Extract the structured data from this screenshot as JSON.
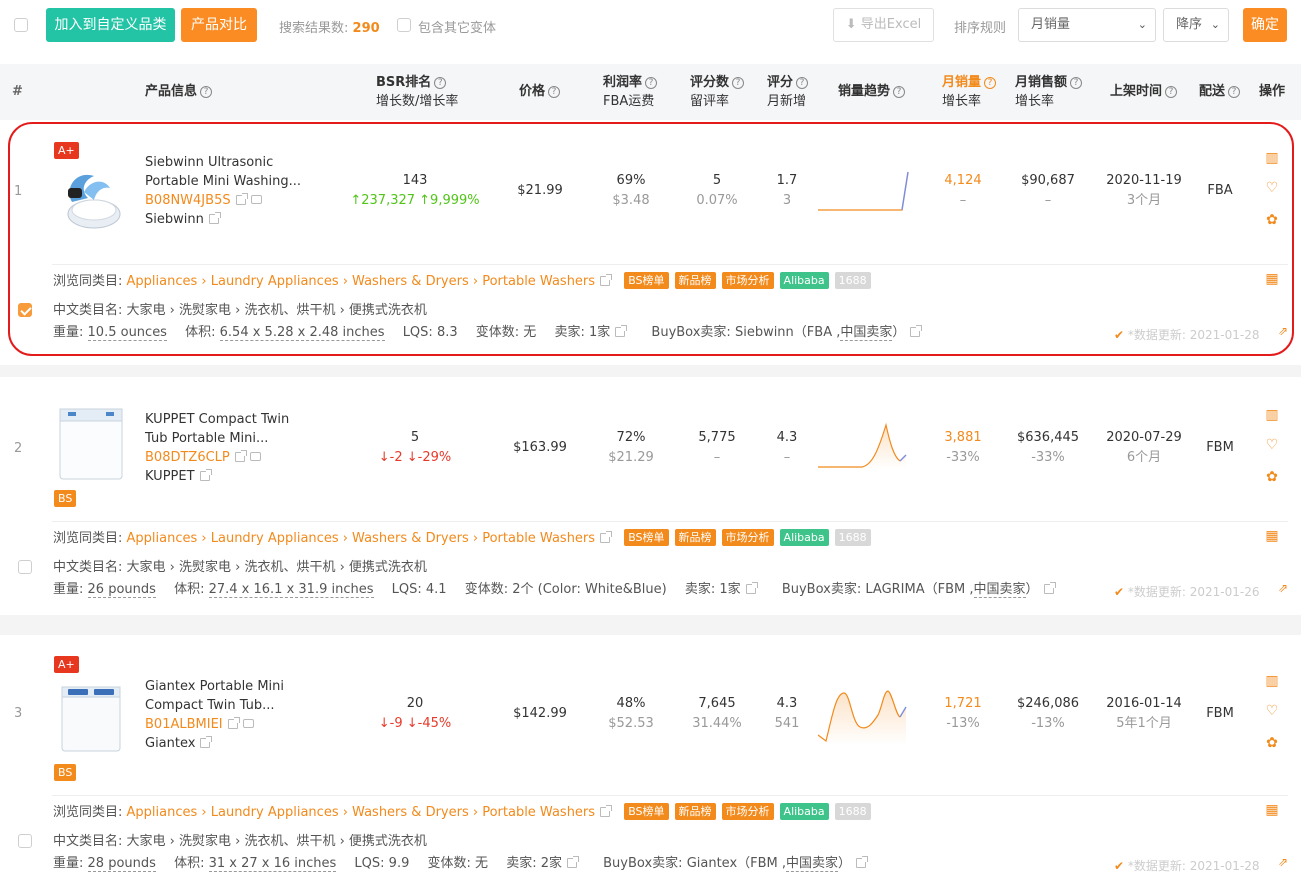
{
  "toolbar": {
    "add_custom": "加入到自定义品类",
    "compare": "产品对比",
    "result_label": "搜索结果数:",
    "result_count": "290",
    "include_variants": "包含其它变体",
    "export": "导出Excel",
    "sort_label": "排序规则",
    "sort_value": "月销量",
    "order_value": "降序",
    "confirm": "确定"
  },
  "header": {
    "index": "#",
    "product": "产品信息",
    "bsr": "BSR排名",
    "bsr_sub": "增长数/增长率",
    "price": "价格",
    "margin": "利润率",
    "margin_sub": "FBA运费",
    "reviews": "评分数",
    "reviews_sub": "留评率",
    "rating": "评分",
    "rating_sub": "月新增",
    "trend": "销量趋势",
    "monthly_sales": "月销量",
    "monthly_sales_sub": "增长率",
    "monthly_revenue": "月销售额",
    "monthly_revenue_sub": "增长率",
    "listed": "上架时间",
    "fulfill": "配送",
    "ops": "操作"
  },
  "labels": {
    "browse": "浏览同类目:",
    "cn_cat": "中文类目名:",
    "weight": "重量:",
    "volume": "体积:",
    "lqs": "LQS:",
    "variants": "变体数:",
    "sellers": "卖家:",
    "buybox": "BuyBox卖家:",
    "bs_list": "BS榜单",
    "new_list": "新品榜",
    "market": "市场分析",
    "alibaba": "Alibaba",
    "t1688": "1688",
    "updated": "*数据更新:"
  },
  "products": [
    {
      "index": "1",
      "badge_top": "A+",
      "badge_bottom": "",
      "name1": "Siebwinn Ultrasonic",
      "name2": "Portable Mini Washing...",
      "asin": "B08NW4JB5S",
      "brand": "Siebwinn",
      "bsr": "143",
      "bsr_change": "↑237,327 ↑9,999%",
      "bsr_dir": "up",
      "price": "$21.99",
      "margin": "69%",
      "fba_fee": "$3.48",
      "reviews": "5",
      "review_rate": "0.07%",
      "rating": "1.7",
      "rating_new": "3",
      "sales": "4,124",
      "sales_growth": "–",
      "revenue": "$90,687",
      "revenue_growth": "–",
      "listed": "2020-11-19",
      "listed_age": "3个月",
      "fulfill": "FBA",
      "category": "Appliances › Laundry Appliances › Washers & Dryers › Portable Washers",
      "cn_category": "大家电 › 洗熨家电 › 洗衣机、烘干机 › 便携式洗衣机",
      "weight": "10.5 ounces",
      "volume": "6.54 x 5.28 x 2.48 inches",
      "lqs": "8.3",
      "variants": "无",
      "sellers": "1家",
      "buybox_seller": "Siebwinn",
      "buybox_type": "（FBA ,",
      "buybox_region": "中国卖家",
      "buybox_close": "）",
      "update_date": "2021-01-28",
      "checked": true
    },
    {
      "index": "2",
      "badge_top": "",
      "badge_bottom": "BS",
      "name1": "KUPPET Compact Twin",
      "name2": "Tub Portable Mini...",
      "asin": "B08DTZ6CLP",
      "brand": "KUPPET",
      "bsr": "5",
      "bsr_change": "↓-2 ↓-29%",
      "bsr_dir": "down",
      "price": "$163.99",
      "margin": "72%",
      "fba_fee": "$21.29",
      "reviews": "5,775",
      "review_rate": "–",
      "rating": "4.3",
      "rating_new": "–",
      "sales": "3,881",
      "sales_growth": "-33%",
      "revenue": "$636,445",
      "revenue_growth": "-33%",
      "listed": "2020-07-29",
      "listed_age": "6个月",
      "fulfill": "FBM",
      "category": "Appliances › Laundry Appliances › Washers & Dryers › Portable Washers",
      "cn_category": "大家电 › 洗熨家电 › 洗衣机、烘干机 › 便携式洗衣机",
      "weight": "26 pounds",
      "volume": "27.4 x 16.1 x 31.9 inches",
      "lqs": "4.1",
      "variants": "2个 (Color: White&Blue)",
      "sellers": "1家",
      "buybox_seller": "LAGRIMA",
      "buybox_type": "（FBM ,",
      "buybox_region": "中国卖家",
      "buybox_close": "）",
      "update_date": "2021-01-26",
      "checked": false
    },
    {
      "index": "3",
      "badge_top": "A+",
      "badge_bottom": "BS",
      "name1": "Giantex Portable Mini",
      "name2": "Compact Twin Tub...",
      "asin": "B01ALBMIEI",
      "brand": "Giantex",
      "bsr": "20",
      "bsr_change": "↓-9 ↓-45%",
      "bsr_dir": "down",
      "price": "$142.99",
      "margin": "48%",
      "fba_fee": "$52.53",
      "reviews": "7,645",
      "review_rate": "31.44%",
      "rating": "4.3",
      "rating_new": "541",
      "sales": "1,721",
      "sales_growth": "-13%",
      "revenue": "$246,086",
      "revenue_growth": "-13%",
      "listed": "2016-01-14",
      "listed_age": "5年1个月",
      "fulfill": "FBM",
      "category": "Appliances › Laundry Appliances › Washers & Dryers › Portable Washers",
      "cn_category": "大家电 › 洗熨家电 › 洗衣机、烘干机 › 便携式洗衣机",
      "weight": "28 pounds",
      "volume": "31 x 27 x 16 inches",
      "lqs": "9.9",
      "variants": "无",
      "sellers": "2家",
      "buybox_seller": "Giantex",
      "buybox_type": "（FBM ,",
      "buybox_region": "中国卖家",
      "buybox_close": "）",
      "update_date": "2021-01-28",
      "checked": false
    }
  ],
  "colors": {
    "accent": "#f28a1c",
    "teal": "#23c4a5",
    "highlight": "#e31b1b",
    "up": "#52c41a",
    "down": "#e83a2a"
  }
}
